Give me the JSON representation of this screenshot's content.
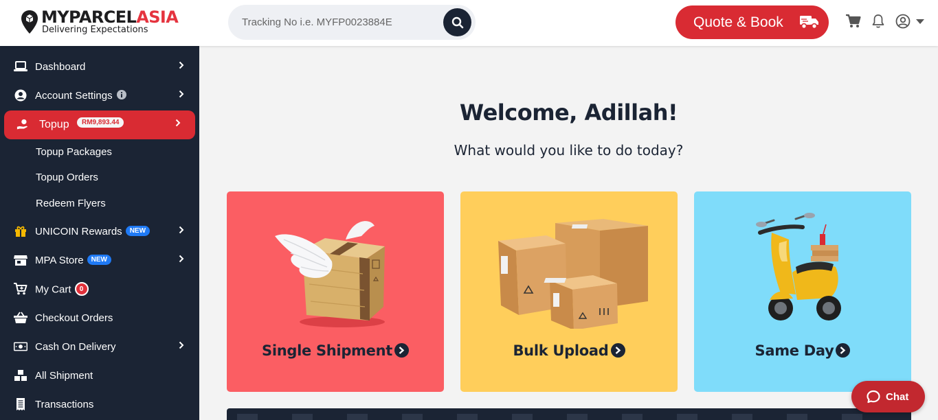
{
  "header": {
    "logo_primary": "MYPARCEL",
    "logo_accent": "ASIA",
    "logo_tagline": "Delivering Expectations",
    "search_placeholder": "Tracking No i.e. MYFP0023884E",
    "quote_label": "Quote & Book",
    "icons": [
      "search-icon",
      "truck-icon",
      "cart-icon",
      "bell-icon",
      "user-icon",
      "caret-down-icon"
    ],
    "accent_color": "#d92b33"
  },
  "sidebar": {
    "items": [
      {
        "label": "Dashboard",
        "icon": "laptop-icon"
      },
      {
        "label": "Account Settings",
        "icon": "user-circle-icon",
        "info_icon": "info-icon"
      },
      {
        "label": "Topup",
        "icon": "hand-coin-icon",
        "badge": "RM9,893.44",
        "active": true
      },
      {
        "label": "UNICOIN Rewards",
        "icon": "gift-icon",
        "badge": "NEW"
      },
      {
        "label": "MPA Store",
        "icon": "store-icon",
        "badge": "NEW"
      },
      {
        "label": "My Cart",
        "icon": "cart-plus-icon",
        "badge": "0"
      },
      {
        "label": "Checkout Orders",
        "icon": "basket-icon"
      },
      {
        "label": "Cash On Delivery",
        "icon": "money-icon"
      },
      {
        "label": "All Shipment",
        "icon": "boxes-icon"
      },
      {
        "label": "Transactions",
        "icon": "receipt-icon"
      }
    ],
    "sub_items": [
      "Topup Packages",
      "Topup Orders",
      "Redeem Flyers"
    ]
  },
  "main": {
    "welcome": "Welcome, Adillah!",
    "subtitle": "What would you like to do today?",
    "cards": [
      {
        "label": "Single Shipment",
        "color": "#fb5e63"
      },
      {
        "label": "Bulk Upload",
        "color": "#ffce5b"
      },
      {
        "label": "Same Day",
        "color": "#7fdcfa"
      }
    ]
  },
  "chat": {
    "label": "Chat"
  }
}
